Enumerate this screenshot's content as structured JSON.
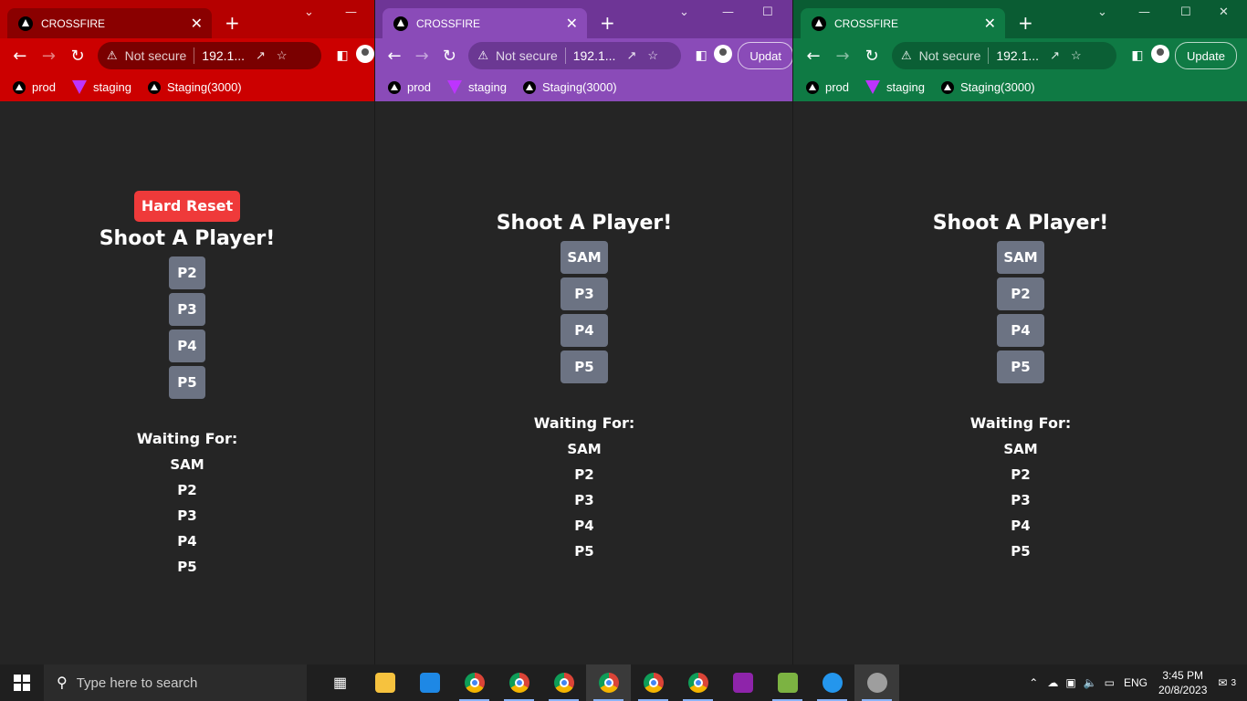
{
  "windows": [
    {
      "id": "w1",
      "theme": "red",
      "tab_title": "CROSSFIRE",
      "not_secure": "Not secure",
      "url": "192.1...",
      "update_label": "",
      "bookmarks": [
        "prod",
        "staging",
        "Staging(3000)"
      ],
      "hard_reset": "Hard Reset",
      "heading": "Shoot A Player!",
      "player_buttons": [
        "P2",
        "P3",
        "P4",
        "P5"
      ],
      "waiting_title": "Waiting For:",
      "waiting": [
        "SAM",
        "P2",
        "P3",
        "P4",
        "P5"
      ]
    },
    {
      "id": "w2",
      "theme": "purple",
      "tab_title": "CROSSFIRE",
      "not_secure": "Not secure",
      "url": "192.1...",
      "update_label": "Updat",
      "bookmarks": [
        "prod",
        "staging",
        "Staging(3000)"
      ],
      "hard_reset": "",
      "heading": "Shoot A Player!",
      "player_buttons": [
        "SAM",
        "P3",
        "P4",
        "P5"
      ],
      "waiting_title": "Waiting For:",
      "waiting": [
        "SAM",
        "P2",
        "P3",
        "P4",
        "P5"
      ]
    },
    {
      "id": "w3",
      "theme": "green",
      "tab_title": "CROSSFIRE",
      "not_secure": "Not secure",
      "url": "192.1...",
      "update_label": "Update",
      "bookmarks": [
        "prod",
        "staging",
        "Staging(3000)"
      ],
      "hard_reset": "",
      "heading": "Shoot A Player!",
      "player_buttons": [
        "SAM",
        "P2",
        "P4",
        "P5"
      ],
      "waiting_title": "Waiting For:",
      "waiting": [
        "SAM",
        "P2",
        "P3",
        "P4",
        "P5"
      ]
    }
  ],
  "colors": {
    "red": {
      "frame": "#b50000",
      "tab": "#8a0000",
      "toolbar": "#cc0000",
      "omni": "#7a0000"
    },
    "purple": {
      "frame": "#6e3596",
      "tab": "#8a4bb8",
      "toolbar": "#8a4bb8",
      "omni": "#6b3893"
    },
    "green": {
      "frame": "#0a5c33",
      "tab": "#0f7a44",
      "toolbar": "#0f7a44",
      "omni": "#0b5f35"
    },
    "player_button": "#6c7383",
    "hard_reset": "#ef3a3a",
    "page_bg": "#252525"
  },
  "taskbar": {
    "search_placeholder": "Type here to search",
    "apps": [
      "task-view",
      "file-explorer",
      "vscode",
      "chrome",
      "chrome-profile-1",
      "chrome-profile-2",
      "chrome-profile-3",
      "chrome-profile-4",
      "chrome-profile-5",
      "pdf-app",
      "sheet-app",
      "docker",
      "paint"
    ],
    "language": "ENG",
    "time": "3:45 PM",
    "date": "20/8/2023",
    "notification_count": "3"
  }
}
